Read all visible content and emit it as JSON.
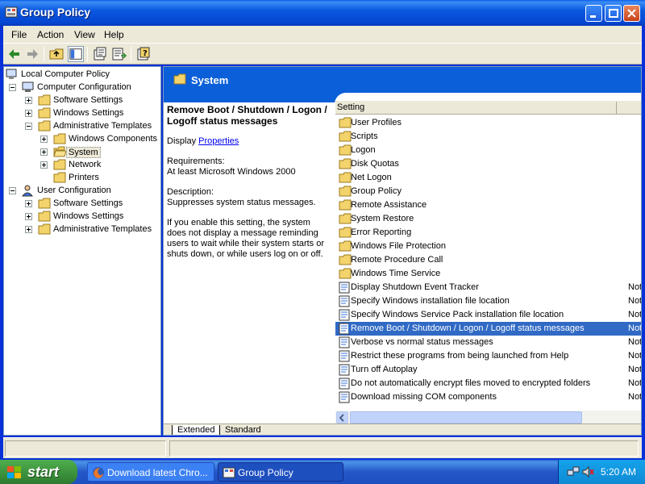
{
  "window": {
    "title": "Group Policy"
  },
  "menu": [
    "File",
    "Action",
    "View",
    "Help"
  ],
  "tree": {
    "root": "Local Computer Policy",
    "computer_config": "Computer Configuration",
    "cc_software": "Software Settings",
    "cc_windows": "Windows Settings",
    "cc_admin": "Administrative Templates",
    "windows_components": "Windows Components",
    "system": "System",
    "network": "Network",
    "printers": "Printers",
    "user_config": "User Configuration",
    "uc_software": "Software Settings",
    "uc_windows": "Windows Settings",
    "uc_admin": "Administrative Templates"
  },
  "pane": {
    "title": "System",
    "desc_title": "Remove Boot / Shutdown / Logon / Logoff status messages",
    "display_prefix": "Display",
    "properties_link": "Properties",
    "requirements_label": "Requirements:",
    "requirements": "At least Microsoft Windows 2000",
    "description_label": "Description:",
    "description": "Suppresses system status messages.",
    "explain": "If you enable this setting, the system does not display a message reminding users to wait while their system starts or shuts down, or while users log on or off.",
    "column_setting": "Setting"
  },
  "folders": [
    "User Profiles",
    "Scripts",
    "Logon",
    "Disk Quotas",
    "Net Logon",
    "Group Policy",
    "Remote Assistance",
    "System Restore",
    "Error Reporting",
    "Windows File Protection",
    "Remote Procedure Call",
    "Windows Time Service"
  ],
  "policies": [
    {
      "name": "Display Shutdown Event Tracker",
      "state": "Not"
    },
    {
      "name": "Specify Windows installation file location",
      "state": "Not"
    },
    {
      "name": "Specify Windows Service Pack installation file location",
      "state": "Not"
    },
    {
      "name": "Remove Boot / Shutdown / Logon / Logoff status messages",
      "state": "Not"
    },
    {
      "name": "Verbose vs normal status messages",
      "state": "Not"
    },
    {
      "name": "Restrict these programs from being launched from Help",
      "state": "Not"
    },
    {
      "name": "Turn off Autoplay",
      "state": "Not"
    },
    {
      "name": "Do not automatically encrypt files moved to encrypted folders",
      "state": "Not"
    },
    {
      "name": "Download missing COM components",
      "state": "Not"
    }
  ],
  "tabs": {
    "extended": "Extended",
    "standard": "Standard"
  },
  "taskbar": {
    "start": "start",
    "task_chrome": "Download latest Chro...",
    "task_gp": "Group Policy",
    "clock": "5:20 AM"
  }
}
